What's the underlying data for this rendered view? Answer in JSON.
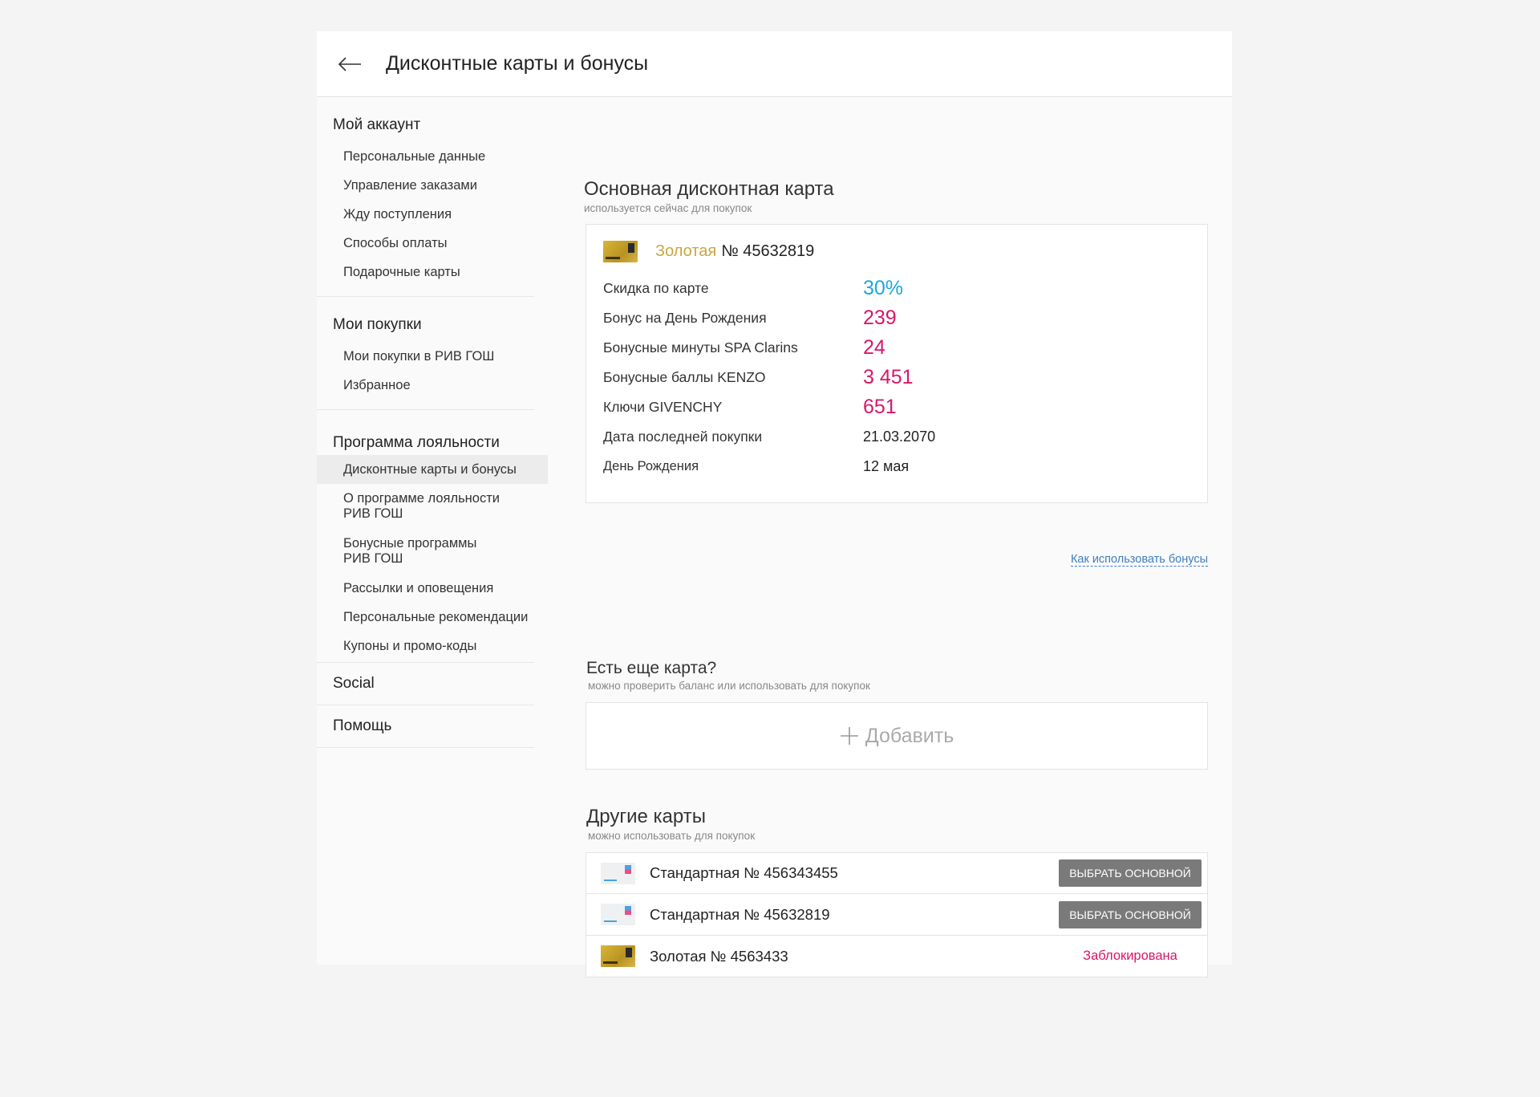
{
  "header": {
    "title": "Дисконтные карты и бонусы"
  },
  "sidebar": {
    "sections": [
      {
        "heading": "Мой аккаунт",
        "items": [
          "Персональные данные",
          "Управление заказами",
          "Жду поступления",
          "Способы оплаты",
          "Подарочные карты"
        ]
      },
      {
        "heading": "Мои покупки",
        "items": [
          "Мои покупки в РИВ ГОШ",
          "Избранное"
        ]
      },
      {
        "heading": "Программа лояльности",
        "items": [
          "Дисконтные карты и бонусы",
          "О программе лояльности\nРИВ ГОШ",
          "Бонусные программы\nРИВ ГОШ",
          "Рассылки и оповещения",
          "Персональные рекомендации",
          "Купоны и промо-коды"
        ],
        "active_index": 0
      },
      {
        "heading": "Social",
        "items": []
      },
      {
        "heading": "Помощь",
        "items": []
      }
    ]
  },
  "main_card": {
    "title": "Основная дисконтная карта",
    "subtitle": "используется сейчас для покупок",
    "level": "Золотая",
    "number": "№ 45632819",
    "stats": [
      {
        "label": "Скидка по карте",
        "value": "30%",
        "color": "#1ca7e0"
      },
      {
        "label": "Бонус на День Рождения",
        "value": "239",
        "color": "#d8176a"
      },
      {
        "label": "Бонусные минуты SPA Clarins",
        "value": "24",
        "color": "#d8176a"
      },
      {
        "label": "Бонусные баллы KENZO",
        "value": "3 451",
        "color": "#d8176a"
      },
      {
        "label": "Ключи GIVENCHY",
        "value": "651",
        "color": "#d8176a"
      },
      {
        "label": "Дата последней покупки",
        "value": "21.03.2070",
        "color": "#222222"
      },
      {
        "label": "День Рождения",
        "value": "12 мая",
        "color": "#222222"
      }
    ],
    "howto_link": "Как использовать бонусы"
  },
  "another_card": {
    "title": "Есть еще карта?",
    "subtitle": "можно проверить баланс или использовать для покупок",
    "add_label": "Добавить"
  },
  "other_cards": {
    "title": "Другие карты",
    "subtitle": "можно использовать для покупок",
    "items": [
      {
        "name": "Стандартная № 456343455",
        "type": "standard",
        "action": "ВЫБРАТЬ ОСНОВНОЙ",
        "blocked": false
      },
      {
        "name": "Стандартная № 45632819",
        "type": "standard",
        "action": "ВЫБРАТЬ ОСНОВНОЙ",
        "blocked": false
      },
      {
        "name": "Золотая № 4563433",
        "type": "gold",
        "status": "Заблокирована",
        "blocked": true
      }
    ]
  },
  "colors": {
    "accent_blue": "#1ca7e0",
    "accent_pink": "#d8176a",
    "gold": "#c9a63f",
    "link": "#3e7fc0"
  }
}
